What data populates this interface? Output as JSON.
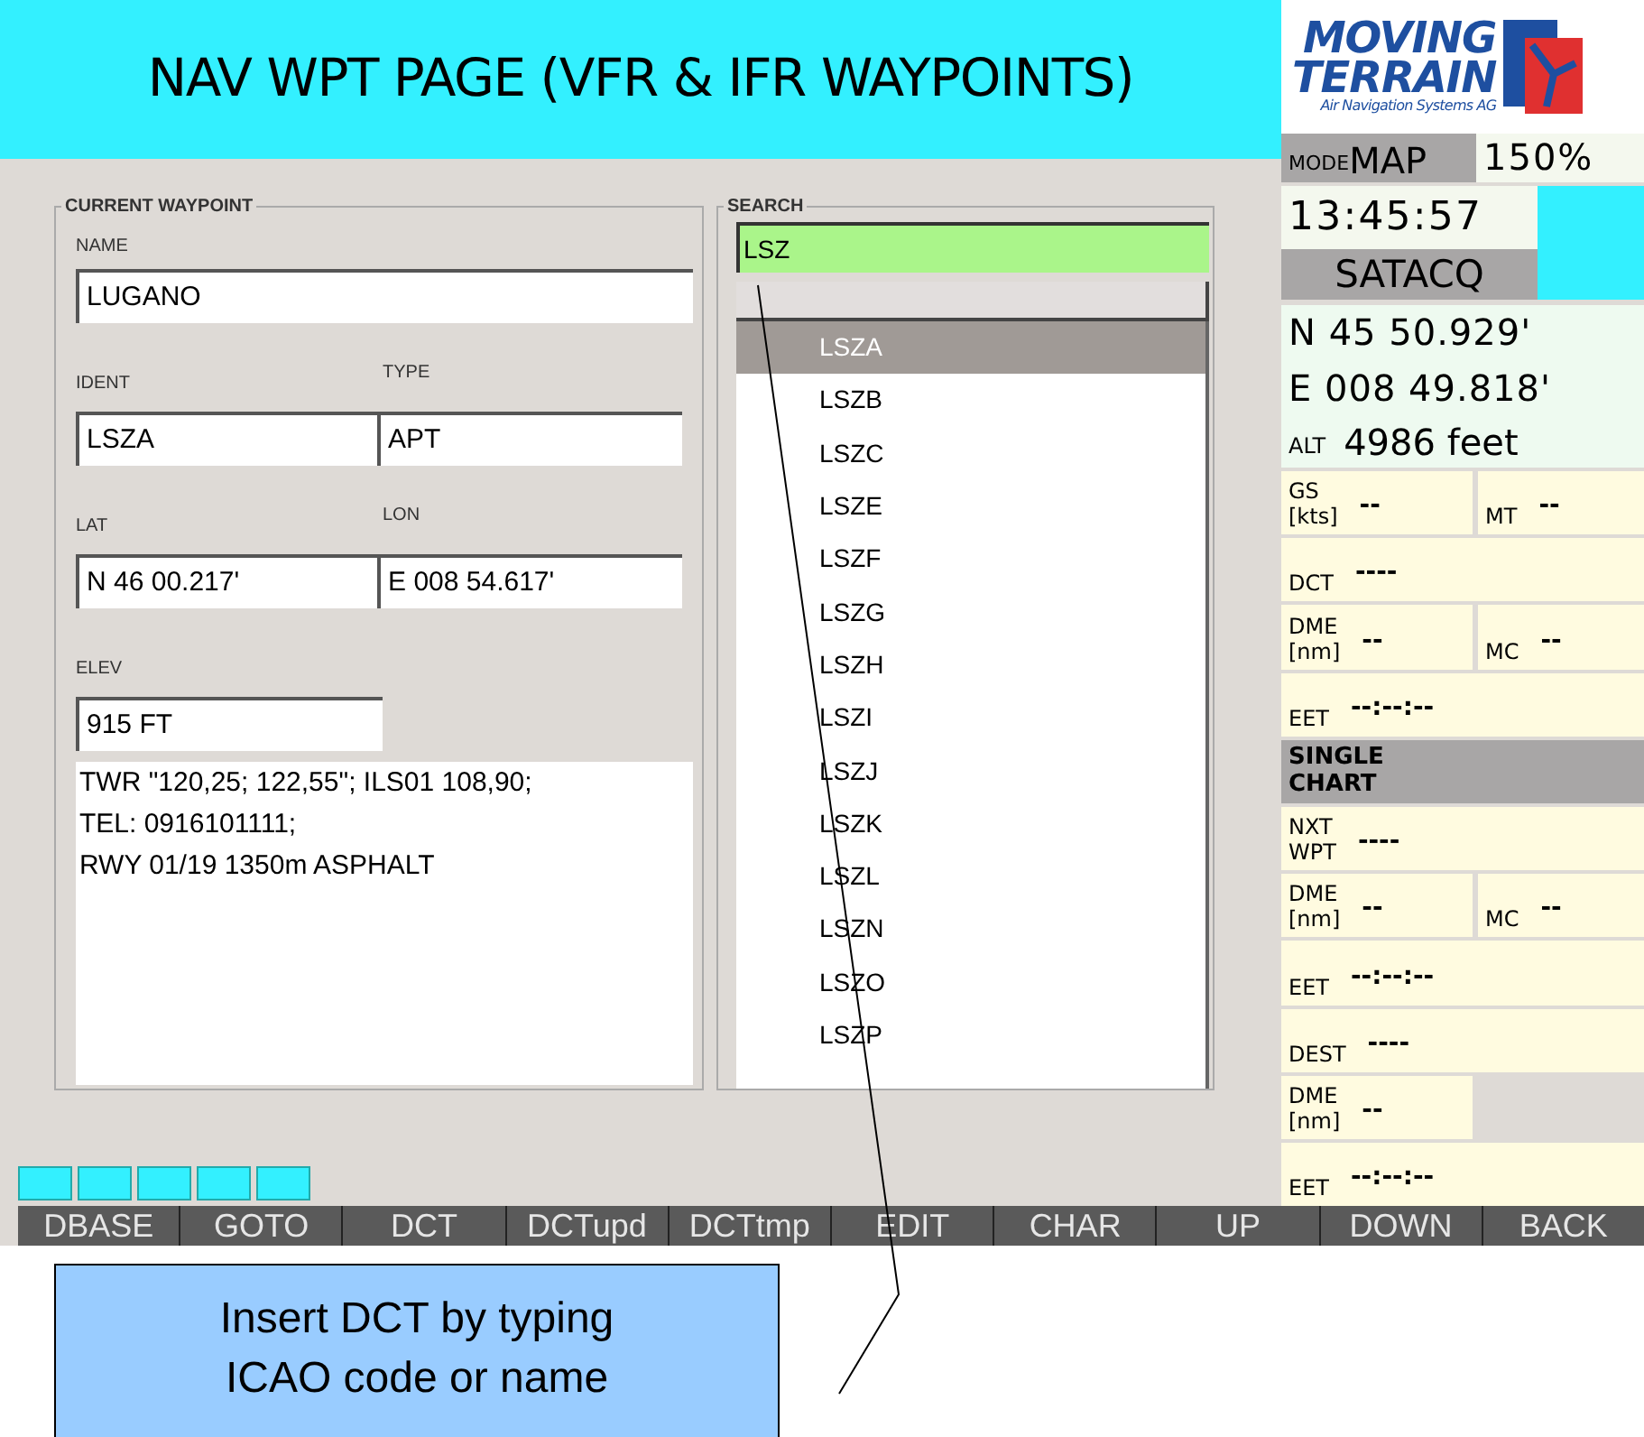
{
  "title": "NAV WPT PAGE (VFR & IFR WAYPOINTS)",
  "logo": {
    "line1": "MOVING",
    "line2": "TERRAIN",
    "tagline": "Air Navigation Systems AG"
  },
  "mode": {
    "label": "MODE",
    "value": "MAP",
    "zoom": "150%"
  },
  "clock": "13:45:57",
  "gps_status": "SATACQ",
  "position": {
    "lat": "N 45 50.929'",
    "lon": "E 008 49.818'",
    "alt_label": "ALT",
    "alt": "4986 feet"
  },
  "nav_rows": [
    {
      "kind": "pair",
      "cells": [
        {
          "label": [
            "GS",
            "[kts]"
          ],
          "value": "--"
        },
        {
          "label": [
            "MT"
          ],
          "value": "--"
        }
      ]
    },
    {
      "kind": "single",
      "cells": [
        {
          "label": [
            "DCT"
          ],
          "value": "----"
        }
      ]
    },
    {
      "kind": "pair",
      "cells": [
        {
          "label": [
            "DME",
            "[nm]"
          ],
          "value": "--"
        },
        {
          "label": [
            "MC"
          ],
          "value": "--"
        }
      ]
    },
    {
      "kind": "single",
      "cells": [
        {
          "label": [
            "EET"
          ],
          "value": "--:--:--"
        }
      ]
    },
    {
      "kind": "header",
      "cells": [
        {
          "label": [
            "SINGLE",
            "CHART"
          ]
        }
      ]
    },
    {
      "kind": "single",
      "cells": [
        {
          "label": [
            "NXT",
            "WPT"
          ],
          "value": "----"
        }
      ]
    },
    {
      "kind": "pair",
      "cells": [
        {
          "label": [
            "DME",
            "[nm]"
          ],
          "value": "--"
        },
        {
          "label": [
            "MC"
          ],
          "value": "--"
        }
      ]
    },
    {
      "kind": "single",
      "cells": [
        {
          "label": [
            "EET"
          ],
          "value": "--:--:--"
        }
      ]
    },
    {
      "kind": "single",
      "cells": [
        {
          "label": [
            "DEST"
          ],
          "value": "----"
        }
      ]
    },
    {
      "kind": "half",
      "cells": [
        {
          "label": [
            "DME",
            "[nm]"
          ],
          "value": "--"
        }
      ]
    },
    {
      "kind": "single",
      "cells": [
        {
          "label": [
            "EET"
          ],
          "value": "--:--:--"
        }
      ]
    }
  ],
  "current_waypoint": {
    "title": "CURRENT WAYPOINT",
    "name": {
      "label": "NAME",
      "value": "LUGANO"
    },
    "ident": {
      "label": "IDENT",
      "value": "LSZA"
    },
    "type": {
      "label": "TYPE",
      "value": "APT"
    },
    "lat": {
      "label": "LAT",
      "value": "N 46 00.217'"
    },
    "lon": {
      "label": "LON",
      "value": "E 008 54.617'"
    },
    "elev": {
      "label": "ELEV",
      "value": "915 FT"
    },
    "remarks": [
      "TWR \"120,25;  122,55\"; ILS01 108,90;",
      "TEL: 0916101111;",
      "RWY 01/19 1350m ASPHALT"
    ]
  },
  "search": {
    "title": "SEARCH",
    "query": "LSZ",
    "results": [
      {
        "label": "LSZA",
        "selected": true
      },
      {
        "label": "LSZB",
        "selected": false
      },
      {
        "label": "LSZC",
        "selected": false
      },
      {
        "label": "LSZE",
        "selected": false
      },
      {
        "label": "LSZF",
        "selected": false
      },
      {
        "label": "LSZG",
        "selected": false
      },
      {
        "label": "LSZH",
        "selected": false
      },
      {
        "label": "LSZI",
        "selected": false
      },
      {
        "label": "LSZJ",
        "selected": false
      },
      {
        "label": "LSZK",
        "selected": false
      },
      {
        "label": "LSZL",
        "selected": false
      },
      {
        "label": "LSZN",
        "selected": false
      },
      {
        "label": "LSZO",
        "selected": false
      },
      {
        "label": "LSZP",
        "selected": false
      }
    ]
  },
  "softkeys": [
    "DBASE",
    "GOTO",
    "DCT",
    "DCTupd",
    "DCTtmp",
    "EDIT",
    "CHAR",
    "UP",
    "DOWN",
    "BACK"
  ],
  "callout": "Insert DCT by typing ICAO code or name"
}
